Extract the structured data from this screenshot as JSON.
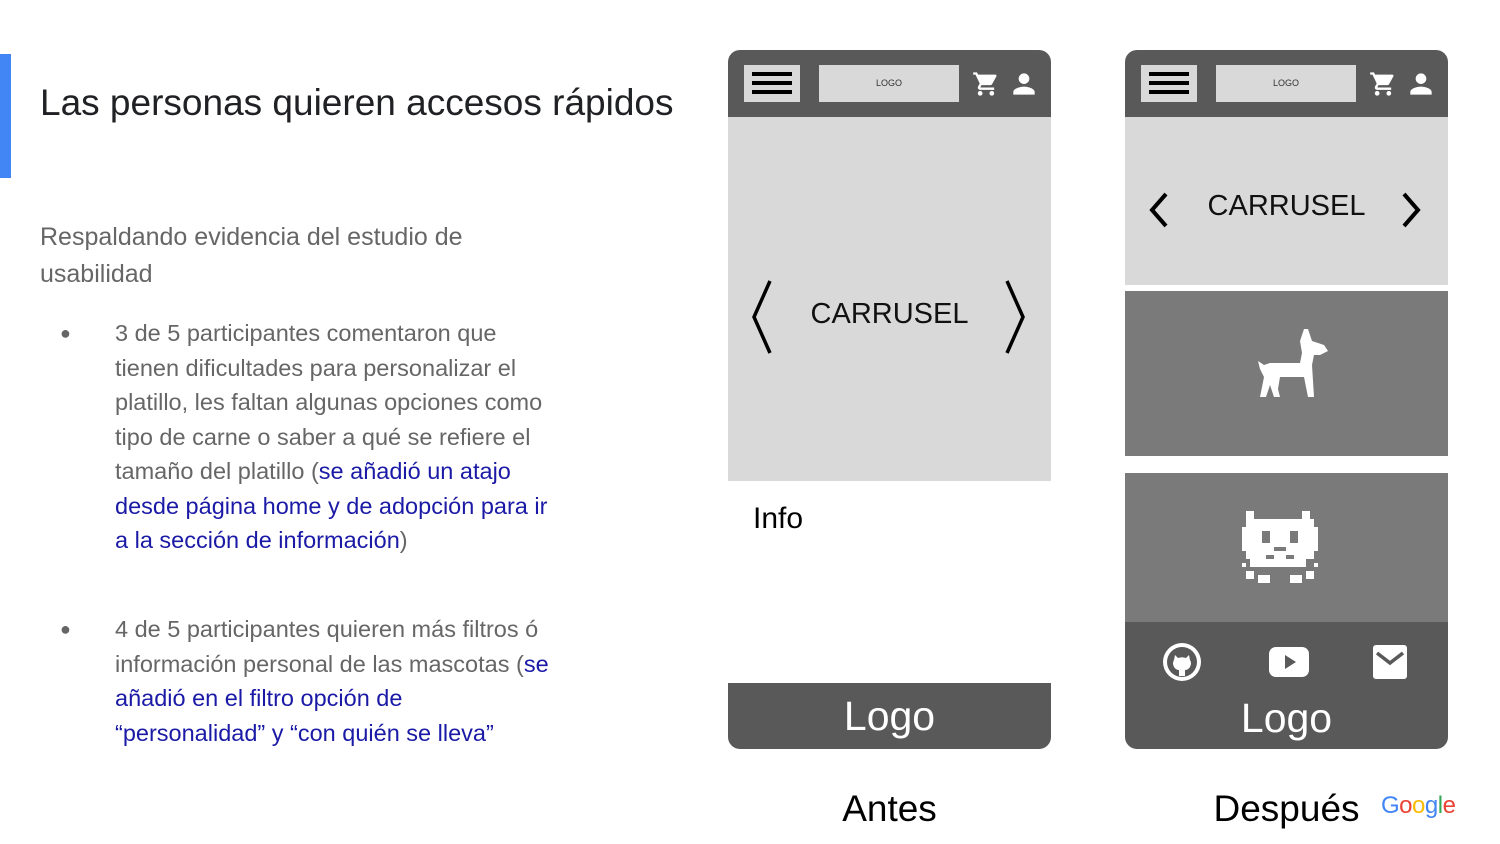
{
  "slide": {
    "title": "Las personas quieren accesos rápidos",
    "intro": "Respaldando evidencia del estudio de usabilidad",
    "bullets": [
      {
        "marker": "●",
        "text": "3 de 5 participantes comentaron que tienen dificultades para personalizar el platillo, les faltan algunas opciones como tipo de carne o saber a qué se refiere el tamaño del platillo (",
        "link": "se añadió un atajo desde página home y de adopción para ir a la sección de información",
        "after": ")"
      },
      {
        "marker": "●",
        "text": "4 de 5 participantes quieren más filtros ó información personal de las mascotas (",
        "link": "se añadió en el filtro opción de “personalidad” y “con quién se lleva”",
        "after": ""
      }
    ]
  },
  "mockup_before": {
    "header_logo": "LOGO",
    "carousel_label": "CARRUSEL",
    "info_label": "Info",
    "footer_logo": "Logo",
    "caption": "Antes"
  },
  "mockup_after": {
    "header_logo": "LOGO",
    "carousel_label": "CARRUSEL",
    "tile_icons": [
      "dog-icon",
      "cat-icon"
    ],
    "footer_icons": [
      "github-icon",
      "youtube-icon",
      "mail-icon"
    ],
    "footer_logo": "Logo",
    "caption": "Después"
  },
  "brand": {
    "text": "Google",
    "letters": [
      "G",
      "o",
      "o",
      "g",
      "l",
      "e"
    ],
    "colors": [
      "#4285f4",
      "#ea4335",
      "#fbbc05",
      "#4285f4",
      "#34a853",
      "#ea4335"
    ]
  },
  "colors": {
    "accent": "#4285f4",
    "link": "#1a1aa6",
    "header_gray": "#595959",
    "light_gray": "#d9d9d9",
    "tile_gray": "#7a7a7a"
  }
}
